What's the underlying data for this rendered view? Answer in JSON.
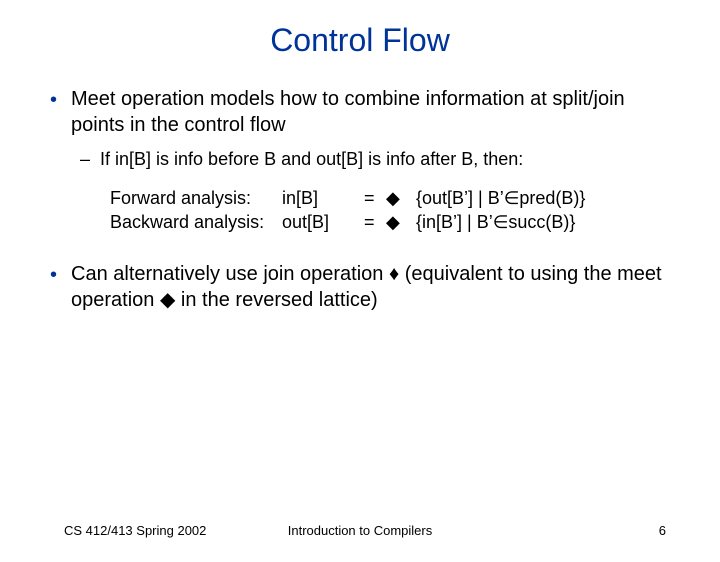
{
  "title": "Control Flow",
  "bullet1a_text": "Meet operation models how to combine information at split/join points in the control flow",
  "bullet2_text": "If in[B] is info before B and out[B] is info after B, then:",
  "eq": {
    "fw_label": "Forward analysis:",
    "fw_lhs": "in[B]",
    "bw_label": "Backward analysis:",
    "bw_lhs": "out[B]",
    "equals": "=",
    "meet": "◆",
    "fw_rhs": "{out[B’] | B’∈pred(B)}",
    "bw_rhs": "{in[B’] | B’∈succ(B)}"
  },
  "bullet1b_pre": "Can alternatively use join operation ",
  "bullet1b_join": "♦",
  "bullet1b_mid": " (equivalent to using the meet operation ",
  "bullet1b_meet": "◆",
  "bullet1b_post": " in the reversed lattice)",
  "footer": {
    "left": "CS 412/413   Spring 2002",
    "center": "Introduction to Compilers",
    "right": "6"
  }
}
